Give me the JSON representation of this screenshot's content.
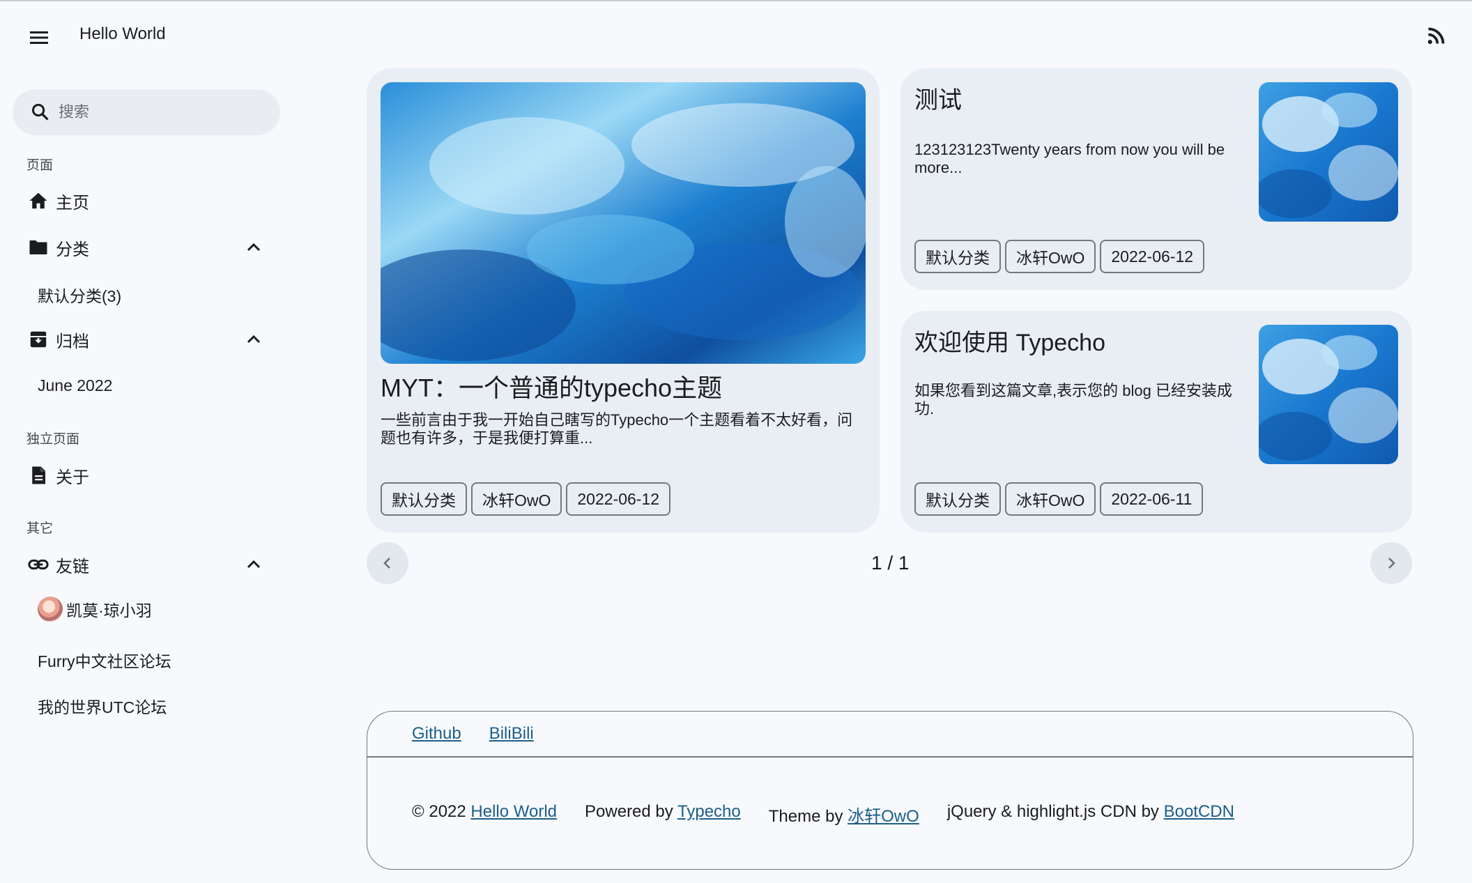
{
  "app": {
    "title": "Hello World"
  },
  "icons": {
    "menu": "hamburger-menu",
    "rss": "rss-feed",
    "search": "magnifier",
    "home": "house",
    "folder": "folder",
    "archive": "archive-box",
    "page": "document",
    "link": "chain-link",
    "chevron": "chevron-up"
  },
  "search": {
    "placeholder": "搜索",
    "value": ""
  },
  "sidebar": {
    "pages_title": "页面",
    "home_label": "主页",
    "category_label": "分类",
    "category_items": [
      "默认分类(3)"
    ],
    "archive_label": "归档",
    "archive_items": [
      "June 2022"
    ],
    "standalone_title": "独立页面",
    "about_label": "关于",
    "other_title": "其它",
    "friends_label": "友链",
    "friends_items": [
      "凯莫·琼小羽",
      "Furry中文社区论坛",
      "我的世界UTC论坛"
    ]
  },
  "posts": [
    {
      "title": "MYT：一个普通的typecho主题",
      "excerpt": "一些前言由于我一开始自己瞎写的Typecho一个主题看着不太好看，问题也有许多，于是我便打算重...",
      "category": "默认分类",
      "author": "冰轩OwO",
      "date": "2022-06-12"
    },
    {
      "title": "测试",
      "excerpt": "123123123Twenty years from now you will be more...",
      "category": "默认分类",
      "author": "冰轩OwO",
      "date": "2022-06-12"
    },
    {
      "title": "欢迎使用 Typecho",
      "excerpt": "如果您看到这篇文章,表示您的 blog 已经安装成功.",
      "category": "默认分类",
      "author": "冰轩OwO",
      "date": "2022-06-11"
    }
  ],
  "pagination": {
    "text": "1 / 1"
  },
  "footer": {
    "links": [
      "Github",
      "BiliBili"
    ],
    "copyright_prefix": "© 2022 ",
    "copyright_link": "Hello World",
    "powered_prefix": "Powered by ",
    "powered_link": "Typecho",
    "theme_prefix": "Theme by ",
    "theme_link": "冰轩OwO",
    "cdn_prefix": "jQuery & highlight.js CDN by ",
    "cdn_link": "BootCDN"
  },
  "colors": {
    "background": "#f7f9fc",
    "card": "#e9eef5",
    "link": "#1c5e8a",
    "outline": "#74777c"
  }
}
